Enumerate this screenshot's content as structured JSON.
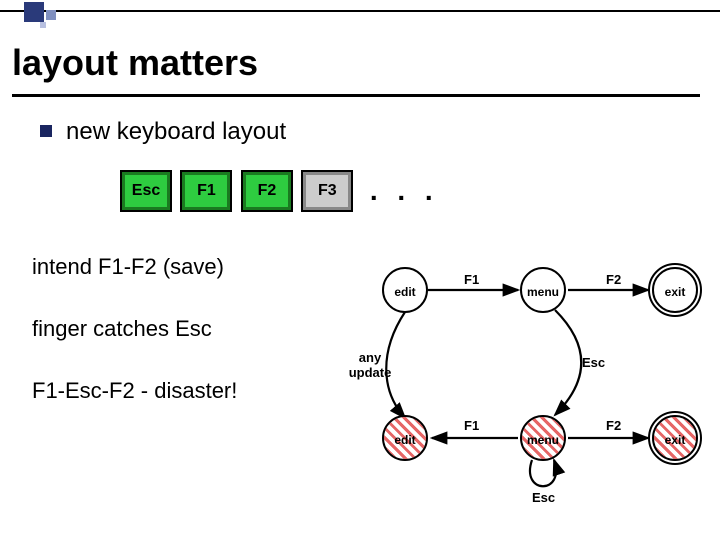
{
  "slide": {
    "title": "layout matters",
    "bullet1": "new keyboard layout",
    "line1": "intend F1-F2 (save)",
    "line2": "finger catches Esc",
    "line3": "F1-Esc-F2 - disaster!"
  },
  "keys": {
    "k1": "Esc",
    "k2": "F1",
    "k3": "F2",
    "k4": "F3",
    "more": ". . ."
  },
  "diagram": {
    "nodes": {
      "edit_top": "edit",
      "menu_top": "menu",
      "exit_top": "exit",
      "edit_bot": "edit",
      "menu_bot": "menu",
      "exit_bot": "exit"
    },
    "edge_labels": {
      "f1_top": "F1",
      "f2_top": "F2",
      "any_update": "any\nupdate",
      "esc_mid": "Esc",
      "f1_bot": "F1",
      "f2_bot": "F2",
      "esc_bot": "Esc"
    }
  }
}
